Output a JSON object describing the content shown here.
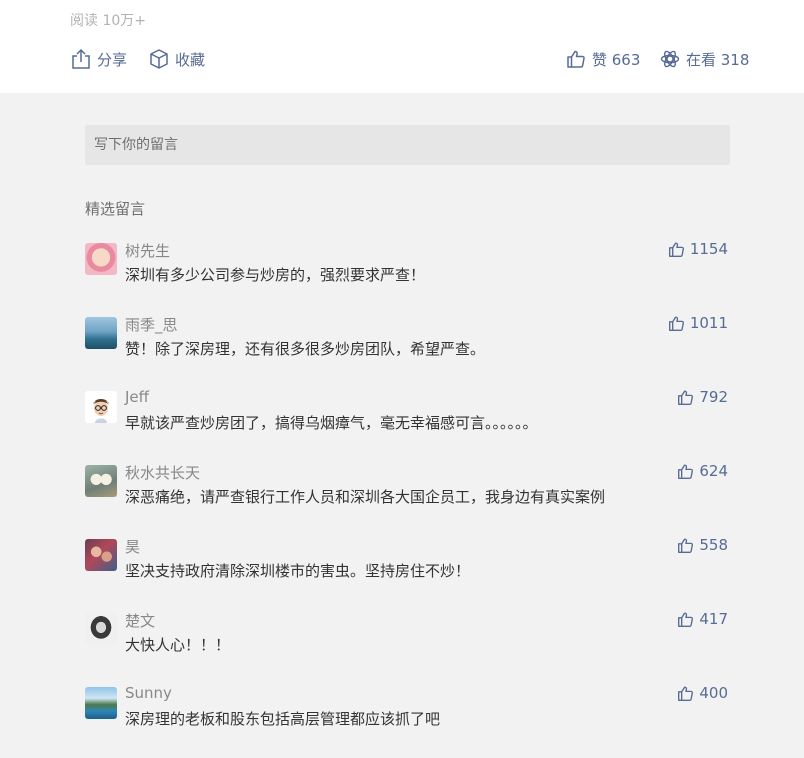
{
  "header": {
    "read_count": "阅读 10万+",
    "share_label": "分享",
    "collect_label": "收藏",
    "like_label": "赞 663",
    "wow_label": "在看 318",
    "icons": [
      "share-icon",
      "collect-icon",
      "thumb-up-icon",
      "wow-icon"
    ],
    "accent_color": "#576b95"
  },
  "comment_input": {
    "placeholder": "写下你的留言"
  },
  "comments_section": {
    "title": "精选留言",
    "comments": [
      {
        "nickname": "树先生",
        "text": "深圳有多少公司参与炒房的，强烈要求严查！",
        "likes": "1154"
      },
      {
        "nickname": "雨季_思",
        "text": "赞！除了深房理，还有很多很多炒房团队，希望严查。",
        "likes": "1011"
      },
      {
        "nickname": "Jeff",
        "text": "早就该严查炒房团了，搞得乌烟瘴气，毫无幸福感可言。。。。。。",
        "likes": "792"
      },
      {
        "nickname": "秋水共长天",
        "text": "深恶痛绝，请严查银行工作人员和深圳各大国企员工，我身边有真实案例",
        "likes": "624"
      },
      {
        "nickname": "昊",
        "text": "坚决支持政府清除深圳楼市的害虫。坚持房住不炒！",
        "likes": "558"
      },
      {
        "nickname": "楚文",
        "text": "大快人心！！！",
        "likes": "417"
      },
      {
        "nickname": "Sunny",
        "text": "深房理的老板和股东包括高层管理都应该抓了吧",
        "likes": "400"
      }
    ]
  }
}
